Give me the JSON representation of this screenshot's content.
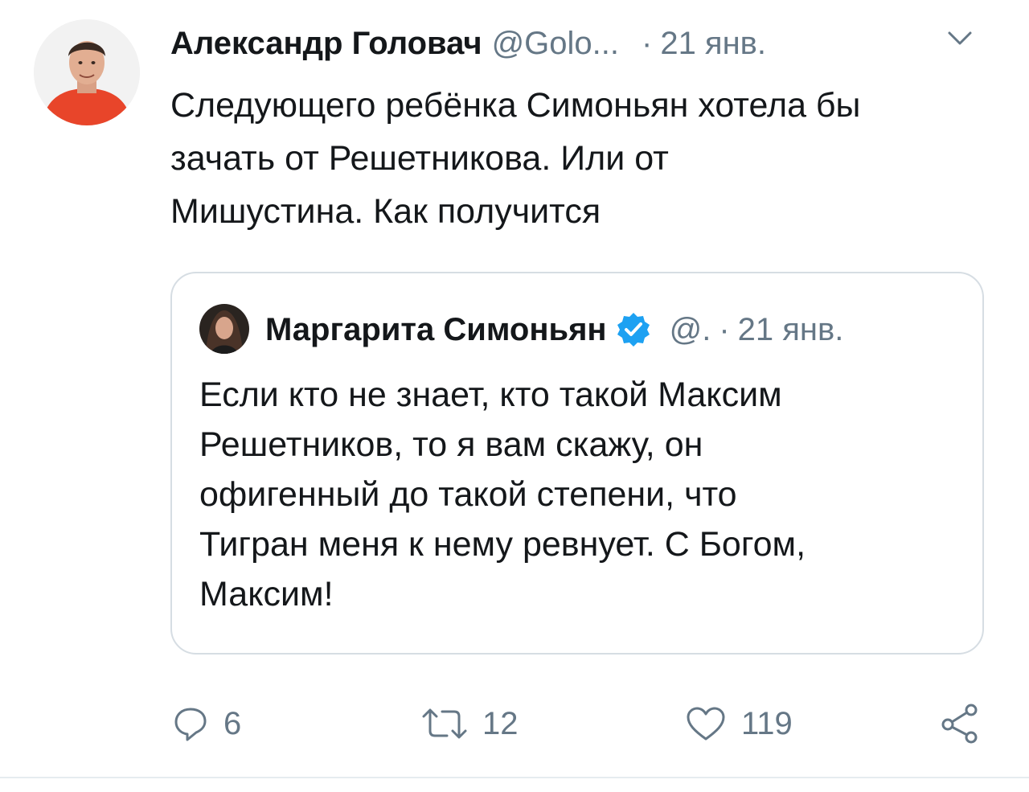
{
  "tweet": {
    "author_name": "Александр Головач",
    "author_handle": "@Golo...",
    "separator": "·",
    "date": "21 янв.",
    "text_lines": [
      "Следующего ребёнка Симоньян хотела бы",
      "зачать от Решетникова. Или от",
      "Мишустина. Как получится"
    ]
  },
  "quoted_tweet": {
    "author_name": "Маргарита Симоньян",
    "author_handle": "@.",
    "separator": "·",
    "date": "21 янв.",
    "text_lines": [
      "Если кто не знает, кто такой Максим",
      "Решетников, то я вам скажу, он",
      "офигенный до такой степени, что",
      "Тигран меня к нему ревнует. С Богом,",
      "Максим!"
    ]
  },
  "actions": {
    "reply_count": "6",
    "retweet_count": "12",
    "like_count": "119"
  },
  "icons": {
    "caret": "chevron-down-icon",
    "verified": "verified-badge-icon",
    "reply": "reply-icon",
    "retweet": "retweet-icon",
    "like": "heart-icon",
    "share": "share-icon"
  },
  "colors": {
    "text": "#14171a",
    "secondary": "#657786",
    "verified": "#1da1f2",
    "border": "#d6dde3",
    "avatar_shirt": "#e8452a"
  }
}
